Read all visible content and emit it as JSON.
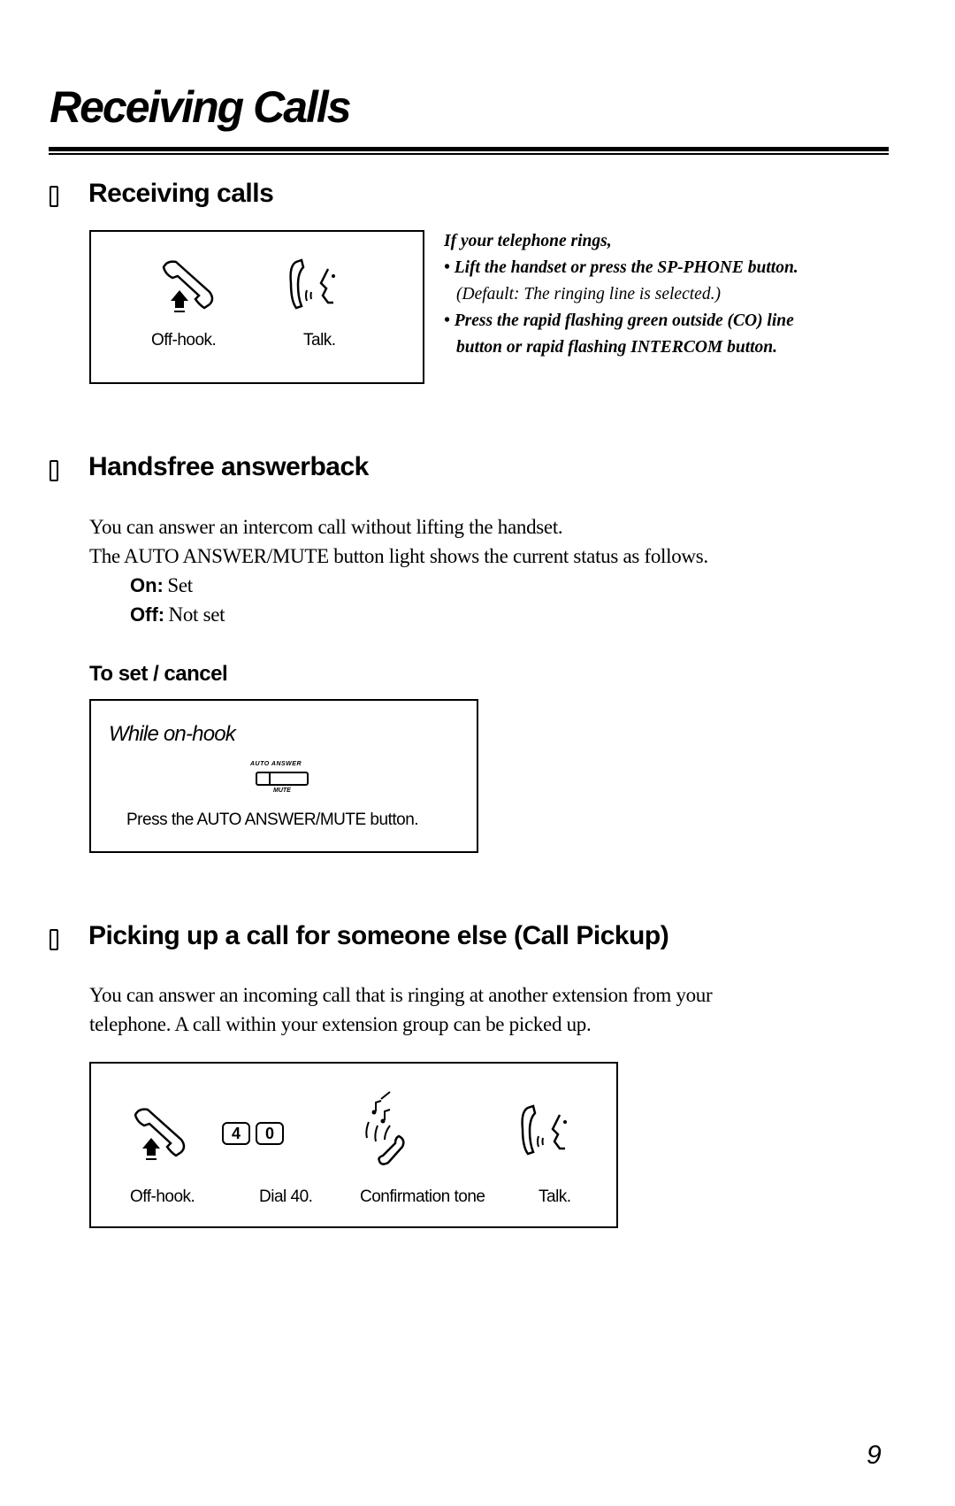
{
  "page": {
    "title": "Receiving Calls",
    "page_number": "9"
  },
  "sections": {
    "receiving": {
      "heading": "Receiving calls",
      "steps": [
        {
          "icon": "off-hook-icon",
          "label": "Off-hook."
        },
        {
          "icon": "talk-icon",
          "label": "Talk."
        }
      ],
      "note": {
        "intro": "If your telephone rings,",
        "bullet1": "Lift the handset or press the SP-PHONE button.",
        "default": "(Default: The ringing line is selected.)",
        "bullet2_line1": "Press the rapid flashing green outside (CO) line",
        "bullet2_line2": "button or rapid flashing INTERCOM button.",
        "bullet_char": "•"
      }
    },
    "handsfree": {
      "heading": "Handsfree answerback",
      "line1": "You can answer an intercom call without lifting the handset.",
      "line2": "The AUTO ANSWER/MUTE button light shows the current status as follows.",
      "status": [
        {
          "key": "On:",
          "value": "Set"
        },
        {
          "key": "Off:",
          "value": "Not set"
        }
      ],
      "set_cancel": {
        "heading": "To set / cancel",
        "condition": "While on-hook",
        "button_top_label": "AUTO ANSWER",
        "button_bottom_label": "MUTE",
        "instruction": "Press the AUTO ANSWER/MUTE button."
      }
    },
    "pickup": {
      "heading": "Picking up a call for someone else (Call Pickup)",
      "line1": "You can answer an incoming call that is ringing at another extension from your",
      "line2": "telephone. A call within your extension group can be picked up.",
      "keys": [
        "4",
        "0"
      ],
      "steps": [
        {
          "icon": "off-hook-icon",
          "label": "Off-hook."
        },
        {
          "icon": "dial-keys-icon",
          "label": "Dial 40."
        },
        {
          "icon": "confirmation-tone-icon",
          "label": "Confirmation tone"
        },
        {
          "icon": "talk-icon",
          "label": "Talk."
        }
      ]
    }
  }
}
